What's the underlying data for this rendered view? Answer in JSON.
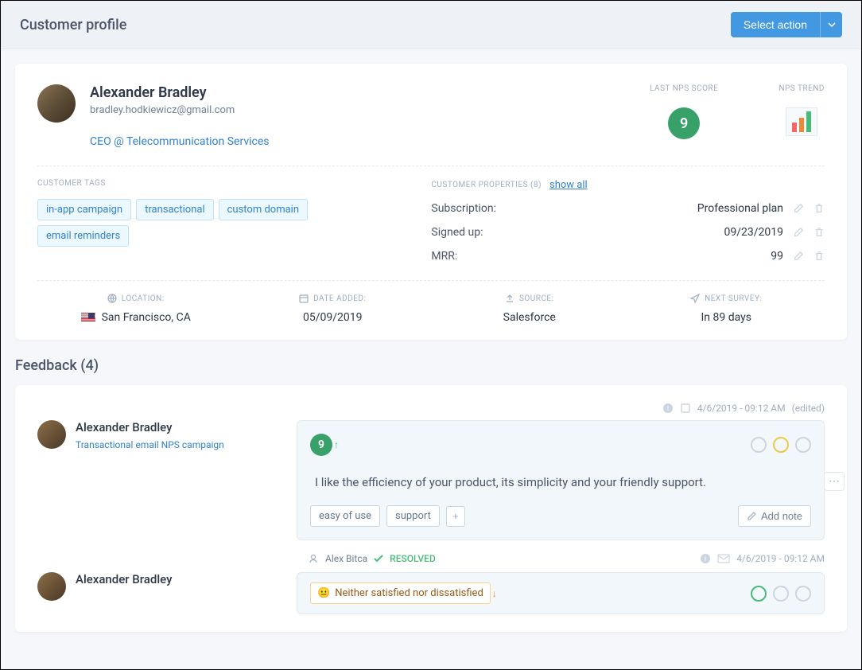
{
  "header": {
    "title": "Customer profile",
    "action_button": "Select action"
  },
  "profile": {
    "name": "Alexander Bradley",
    "email": "bradley.hodkiewicz@gmail.com",
    "role": "CEO @ Telecommunication Services",
    "stats": {
      "nps_score_label": "LAST NPS SCORE",
      "nps_score": "9",
      "nps_trend_label": "NPS TREND"
    }
  },
  "tags": {
    "label": "CUSTOMER TAGS",
    "items": [
      "in-app campaign",
      "transactional",
      "custom domain",
      "email reminders"
    ]
  },
  "properties": {
    "label": "CUSTOMER PROPERTIES (8)",
    "show_all": "show all",
    "rows": [
      {
        "key": "Subscription:",
        "value": "Professional plan"
      },
      {
        "key": "Signed up:",
        "value": "09/23/2019"
      },
      {
        "key": "MRR:",
        "value": "99"
      }
    ]
  },
  "info": {
    "location_label": "LOCATION:",
    "location": "San Francisco, CA",
    "date_added_label": "DATE ADDED:",
    "date_added": "05/09/2019",
    "source_label": "SOURCE:",
    "source": "Salesforce",
    "next_survey_label": "NEXT SURVEY:",
    "next_survey": "In 89 days"
  },
  "feedback": {
    "title": "Feedback (4)",
    "items": [
      {
        "timestamp": "4/6/2019 - 09:12 AM",
        "edited": "(edited)",
        "author": "Alexander Bradley",
        "campaign": "Transactional email NPS campaign",
        "score": "9",
        "text": "I like the efficiency of your product, its simplicity and your friendly support.",
        "tags": [
          "easy of use",
          "support"
        ],
        "add_note": "Add note"
      }
    ],
    "reply": {
      "author": "Alex Bitca",
      "status": "RESOLVED",
      "timestamp": "4/6/2019 - 09:12 AM"
    },
    "second": {
      "author": "Alexander Bradley",
      "sentiment": "Neither satisfied nor dissatisfied"
    }
  }
}
